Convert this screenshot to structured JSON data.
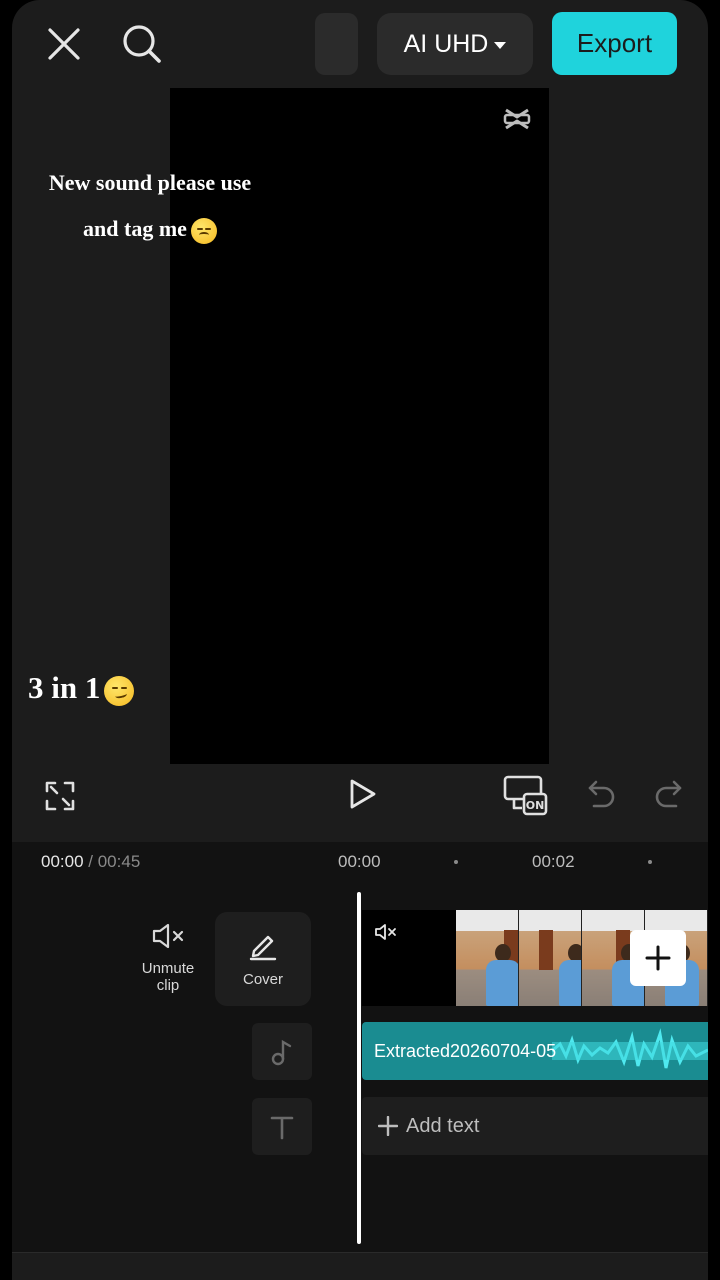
{
  "header": {
    "quality_label": "AI UHD",
    "export_label": "Export",
    "icons": [
      "close-icon",
      "search-icon",
      "chevron-down-icon"
    ]
  },
  "preview": {
    "caption_line1": "New sound please use",
    "caption_line2": "and tag me",
    "caption_bottom": "3 in 1",
    "watermark_icon": "capcut-logo-icon",
    "emojis": [
      "disappointed-face-emoji",
      "smirking-face-emoji"
    ]
  },
  "controls": {
    "icons": [
      "fullscreen-icon",
      "play-icon",
      "auto-caption-on-icon",
      "undo-icon",
      "redo-icon"
    ],
    "badge": "ON"
  },
  "timeline": {
    "current_time": "00:00",
    "total_time": "/ 00:45",
    "ticks": [
      "00:00",
      "00:02"
    ],
    "unmute_label": "Unmute clip",
    "cover_label": "Cover",
    "audio_clip_name": "Extracted20260704-05",
    "add_text_label": "Add text"
  },
  "colors": {
    "accent": "#1fd3dc",
    "audio_track": "#1a8c91",
    "background": "#1c1c1c"
  }
}
